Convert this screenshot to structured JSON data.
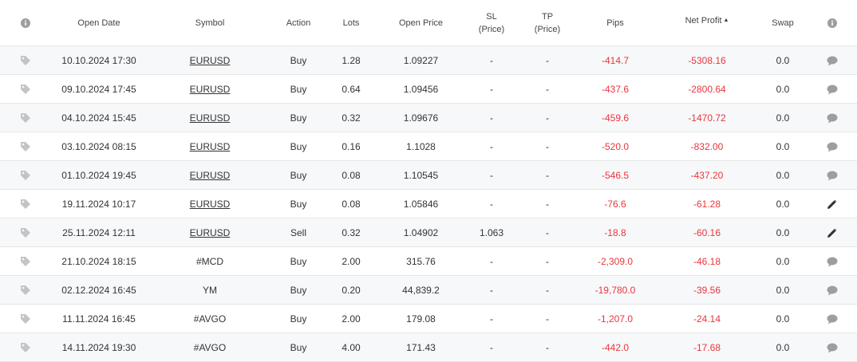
{
  "colors": {
    "negative": "#e8363d",
    "icon_gray": "#9e9e9e",
    "edit_icon": "#333333",
    "row_alt": "#f7f8fa",
    "border": "#e6e6e6"
  },
  "header": {
    "info_icon": "info-icon",
    "open_date": "Open Date",
    "symbol": "Symbol",
    "action": "Action",
    "lots": "Lots",
    "open_price": "Open Price",
    "sl_line1": "SL",
    "sl_line2": "(Price)",
    "tp_line1": "TP",
    "tp_line2": "(Price)",
    "pips": "Pips",
    "net_profit": "Net Profit",
    "net_profit_sort": "▲",
    "swap": "Swap",
    "info_icon_right": "info-icon"
  },
  "trades": [
    {
      "date": "10.10.2024 17:30",
      "symbol": "EURUSD",
      "link": true,
      "action": "Buy",
      "lots": "1.28",
      "open_price": "1.09227",
      "sl": "-",
      "tp": "-",
      "pips": "-414.7",
      "net_profit": "-5308.16",
      "swap": "0.0",
      "row_icon": "comment-icon"
    },
    {
      "date": "09.10.2024 17:45",
      "symbol": "EURUSD",
      "link": true,
      "action": "Buy",
      "lots": "0.64",
      "open_price": "1.09456",
      "sl": "-",
      "tp": "-",
      "pips": "-437.6",
      "net_profit": "-2800.64",
      "swap": "0.0",
      "row_icon": "comment-icon"
    },
    {
      "date": "04.10.2024 15:45",
      "symbol": "EURUSD",
      "link": true,
      "action": "Buy",
      "lots": "0.32",
      "open_price": "1.09676",
      "sl": "-",
      "tp": "-",
      "pips": "-459.6",
      "net_profit": "-1470.72",
      "swap": "0.0",
      "row_icon": "comment-icon"
    },
    {
      "date": "03.10.2024 08:15",
      "symbol": "EURUSD",
      "link": true,
      "action": "Buy",
      "lots": "0.16",
      "open_price": "1.1028",
      "sl": "-",
      "tp": "-",
      "pips": "-520.0",
      "net_profit": "-832.00",
      "swap": "0.0",
      "row_icon": "comment-icon"
    },
    {
      "date": "01.10.2024 19:45",
      "symbol": "EURUSD",
      "link": true,
      "action": "Buy",
      "lots": "0.08",
      "open_price": "1.10545",
      "sl": "-",
      "tp": "-",
      "pips": "-546.5",
      "net_profit": "-437.20",
      "swap": "0.0",
      "row_icon": "comment-icon"
    },
    {
      "date": "19.11.2024 10:17",
      "symbol": "EURUSD",
      "link": true,
      "action": "Buy",
      "lots": "0.08",
      "open_price": "1.05846",
      "sl": "-",
      "tp": "-",
      "pips": "-76.6",
      "net_profit": "-61.28",
      "swap": "0.0",
      "row_icon": "pencil-icon"
    },
    {
      "date": "25.11.2024 12:11",
      "symbol": "EURUSD",
      "link": true,
      "action": "Sell",
      "lots": "0.32",
      "open_price": "1.04902",
      "sl": "1.063",
      "tp": "-",
      "pips": "-18.8",
      "net_profit": "-60.16",
      "swap": "0.0",
      "row_icon": "pencil-icon"
    },
    {
      "date": "21.10.2024 18:15",
      "symbol": "#MCD",
      "link": false,
      "action": "Buy",
      "lots": "2.00",
      "open_price": "315.76",
      "sl": "-",
      "tp": "-",
      "pips": "-2,309.0",
      "net_profit": "-46.18",
      "swap": "0.0",
      "row_icon": "comment-icon"
    },
    {
      "date": "02.12.2024 16:45",
      "symbol": "YM",
      "link": false,
      "action": "Buy",
      "lots": "0.20",
      "open_price": "44,839.2",
      "sl": "-",
      "tp": "-",
      "pips": "-19,780.0",
      "net_profit": "-39.56",
      "swap": "0.0",
      "row_icon": "comment-icon"
    },
    {
      "date": "11.11.2024 16:45",
      "symbol": "#AVGO",
      "link": false,
      "action": "Buy",
      "lots": "2.00",
      "open_price": "179.08",
      "sl": "-",
      "tp": "-",
      "pips": "-1,207.0",
      "net_profit": "-24.14",
      "swap": "0.0",
      "row_icon": "comment-icon"
    },
    {
      "date": "14.11.2024 19:30",
      "symbol": "#AVGO",
      "link": false,
      "action": "Buy",
      "lots": "4.00",
      "open_price": "171.43",
      "sl": "-",
      "tp": "-",
      "pips": "-442.0",
      "net_profit": "-17.68",
      "swap": "0.0",
      "row_icon": "comment-icon"
    }
  ]
}
